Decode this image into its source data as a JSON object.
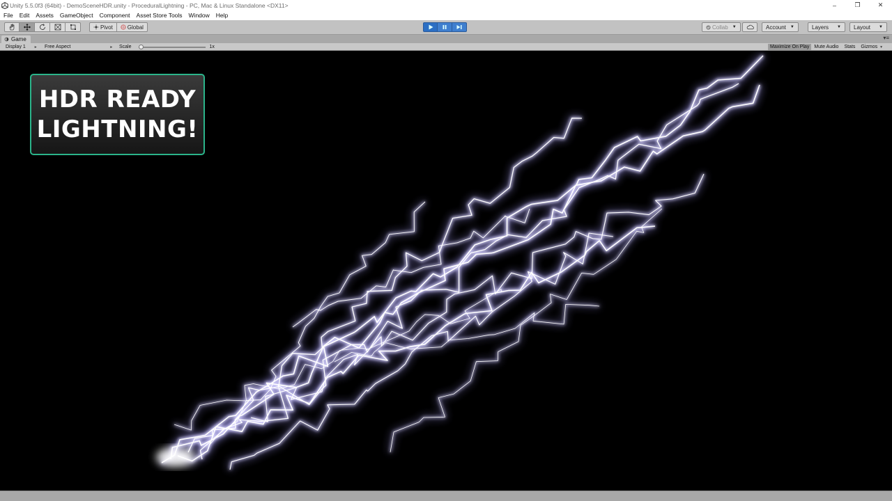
{
  "window": {
    "title": "Unity 5.5.0f3 (64bit) - DemoSceneHDR.unity - ProceduralLightning - PC, Mac & Linux Standalone <DX11>",
    "controls": {
      "minimize": "–",
      "restore": "❐",
      "close": "✕"
    }
  },
  "menu": [
    "File",
    "Edit",
    "Assets",
    "GameObject",
    "Component",
    "Asset Store Tools",
    "Window",
    "Help"
  ],
  "toolbar": {
    "tools": [
      "hand-icon",
      "move-icon",
      "rotate-icon",
      "scale-icon",
      "rect-icon"
    ],
    "active_tool": "move-icon",
    "pivot_label": "Pivot",
    "global_label": "Global",
    "play": {
      "play_active": true,
      "pause_active": false
    },
    "collab_label": "Collab",
    "account_label": "Account",
    "layers_label": "Layers",
    "layout_label": "Layout"
  },
  "game_tab": {
    "label": "Game"
  },
  "game_bar": {
    "display": "Display 1",
    "aspect": "Free Aspect",
    "scale_label": "Scale",
    "scale_value": "1x",
    "scale_position": 0,
    "maximize_label": "Maximize On Play",
    "mute_label": "Mute Audio",
    "stats_label": "Stats",
    "gizmos_label": "Gizmos"
  },
  "game_view": {
    "badge_line1": "HDR READY",
    "badge_line2": "LIGHTNING!",
    "badge_border_color": "#2bb48a",
    "lightning_color": "#a7a0ff"
  }
}
